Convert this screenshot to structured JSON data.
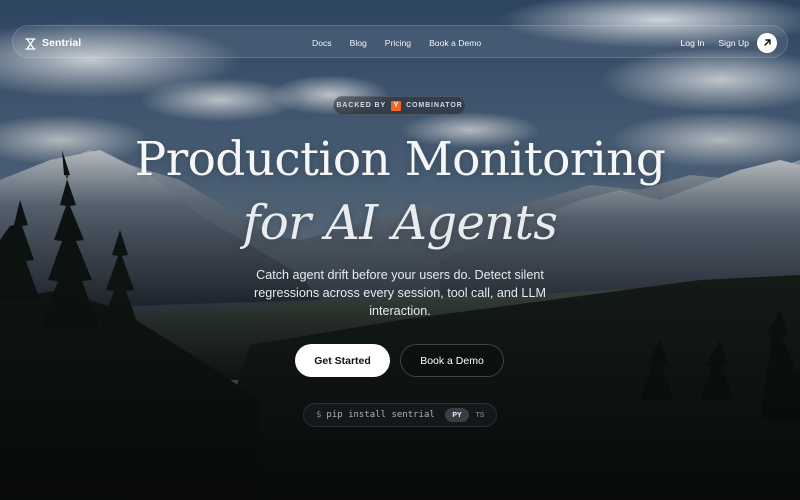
{
  "nav": {
    "brand": "Sentrial",
    "links": [
      "Docs",
      "Blog",
      "Pricing",
      "Book a Demo"
    ],
    "login": "Log In",
    "signup": "Sign Up"
  },
  "badge": {
    "prefix": "BACKED BY",
    "logo_letter": "Y",
    "suffix": "COMBINATOR"
  },
  "hero": {
    "title": "Production Monitoring",
    "subtitle": "for AI Agents",
    "description": "Catch agent drift before your users do. Detect silent regressions across every session, tool call, and LLM interaction."
  },
  "cta": {
    "primary": "Get Started",
    "secondary": "Book a Demo"
  },
  "install": {
    "prompt": "$",
    "command": "pip install sentrial",
    "tabs": [
      "PY",
      "TS"
    ],
    "active_tab": "PY"
  },
  "colors": {
    "yc_orange": "#f26522",
    "primary_button_bg": "#ffffff"
  },
  "icons": {
    "brand": "hourglass-icon",
    "signup_arrow": "arrow-up-right-icon"
  }
}
